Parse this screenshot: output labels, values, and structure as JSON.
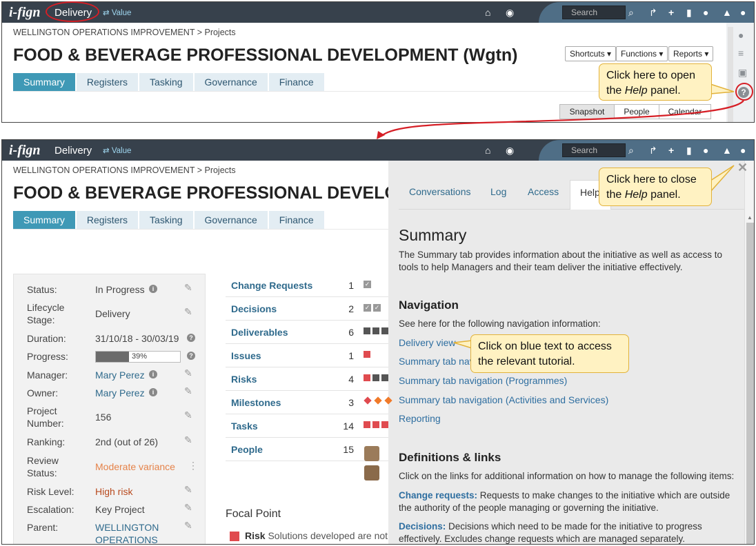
{
  "header": {
    "logo": "i-fign",
    "app_name": "Delivery",
    "value_link": "⇄ Value",
    "search_placeholder": "Search"
  },
  "breadcrumb": "WELLINGTON OPERATIONS IMPROVEMENT > Projects",
  "page_title": "FOOD & BEVERAGE PROFESSIONAL DEVELOPMENT (Wgtn)",
  "page_title_cut": "FOOD & BEVERAGE PROFESSIONAL DEVELOI",
  "tabs": [
    "Summary",
    "Registers",
    "Tasking",
    "Governance",
    "Finance"
  ],
  "dropdowns": {
    "shortcuts": "Shortcuts ▾",
    "functions": "Functions ▾",
    "reports": "Reports ▾"
  },
  "views": [
    "Snapshot",
    "People",
    "Calendar"
  ],
  "callouts": {
    "open_help": [
      "Click here to open",
      "the",
      "Help",
      "panel."
    ],
    "close_help": [
      "Click here to close",
      "the",
      "Help",
      "panel."
    ],
    "blue_text": [
      "Click on blue text to access",
      "the relevant tutorial."
    ]
  },
  "status_panel": [
    {
      "label": "Status:",
      "value": "In Progress",
      "action": "info"
    },
    {
      "label": "Lifecycle Stage:",
      "value": "Delivery",
      "action": "edit"
    },
    {
      "label": "Duration:",
      "value": "31/10/18 - 30/03/19",
      "action": "help"
    },
    {
      "label": "Progress:",
      "value": "39%",
      "action": "help"
    },
    {
      "label": "Manager:",
      "value": "Mary Perez",
      "action": "edit"
    },
    {
      "label": "Owner:",
      "value": "Mary Perez",
      "action": "edit"
    },
    {
      "label": "Project Number:",
      "value": "156",
      "action": "edit"
    },
    {
      "label": "Ranking:",
      "value": "2nd (out of 26)",
      "action": "edit"
    },
    {
      "label": "Review Status:",
      "value": "Moderate variance",
      "action": "more"
    },
    {
      "label": "Risk Level:",
      "value": "High risk",
      "action": "edit"
    },
    {
      "label": "Escalation:",
      "value": "Key Project",
      "action": "edit"
    },
    {
      "label": "Parent:",
      "value": "WELLINGTON OPERATIONS",
      "action": "edit"
    }
  ],
  "progress_value": 0.39,
  "colors": {
    "link": "#2f6a8c",
    "moderate": "#e5834a",
    "high_risk": "#b84a1e",
    "red": "#e04b4f",
    "orange": "#f07a2a",
    "accent": "#3f99b6"
  },
  "metrics": [
    {
      "name": "Change Requests",
      "count": "1"
    },
    {
      "name": "Decisions",
      "count": "2"
    },
    {
      "name": "Deliverables",
      "count": "6"
    },
    {
      "name": "Issues",
      "count": "1"
    },
    {
      "name": "Risks",
      "count": "4"
    },
    {
      "name": "Milestones",
      "count": "3"
    },
    {
      "name": "Tasks",
      "count": "14"
    },
    {
      "name": "People",
      "count": "15"
    }
  ],
  "focal_point": {
    "title": "Focal Point",
    "risk_label": "Risk",
    "risk_text": "Solutions developed are not i"
  },
  "help_panel": {
    "tabs": [
      "Conversations",
      "Log",
      "Access",
      "Help"
    ],
    "summary_title": "Summary",
    "summary_text": "The Summary tab provides information about the initiative as well as access to tools to help Managers and their team deliver the initiative effectively.",
    "navigation_title": "Navigation",
    "navigation_intro": "See here for the following navigation information:",
    "nav_links": [
      "Delivery view",
      "Summary tab navi",
      "Summary tab navigation (Programmes)",
      "Summary tab navigation (Activities and Services)",
      "Reporting"
    ],
    "definitions_title": "Definitions & links",
    "definitions_intro": "Click on the links for additional information on how to manage the following items:",
    "definitions": [
      {
        "term": "Change requests:",
        "text": "Requests to make changes to the initiative which are outside the authority of the people managing or governing the initiative."
      },
      {
        "term": "Decisions:",
        "text": "Decisions which need to be made for the initiative to progress effectively. Excludes change requests which are managed separately."
      }
    ]
  }
}
